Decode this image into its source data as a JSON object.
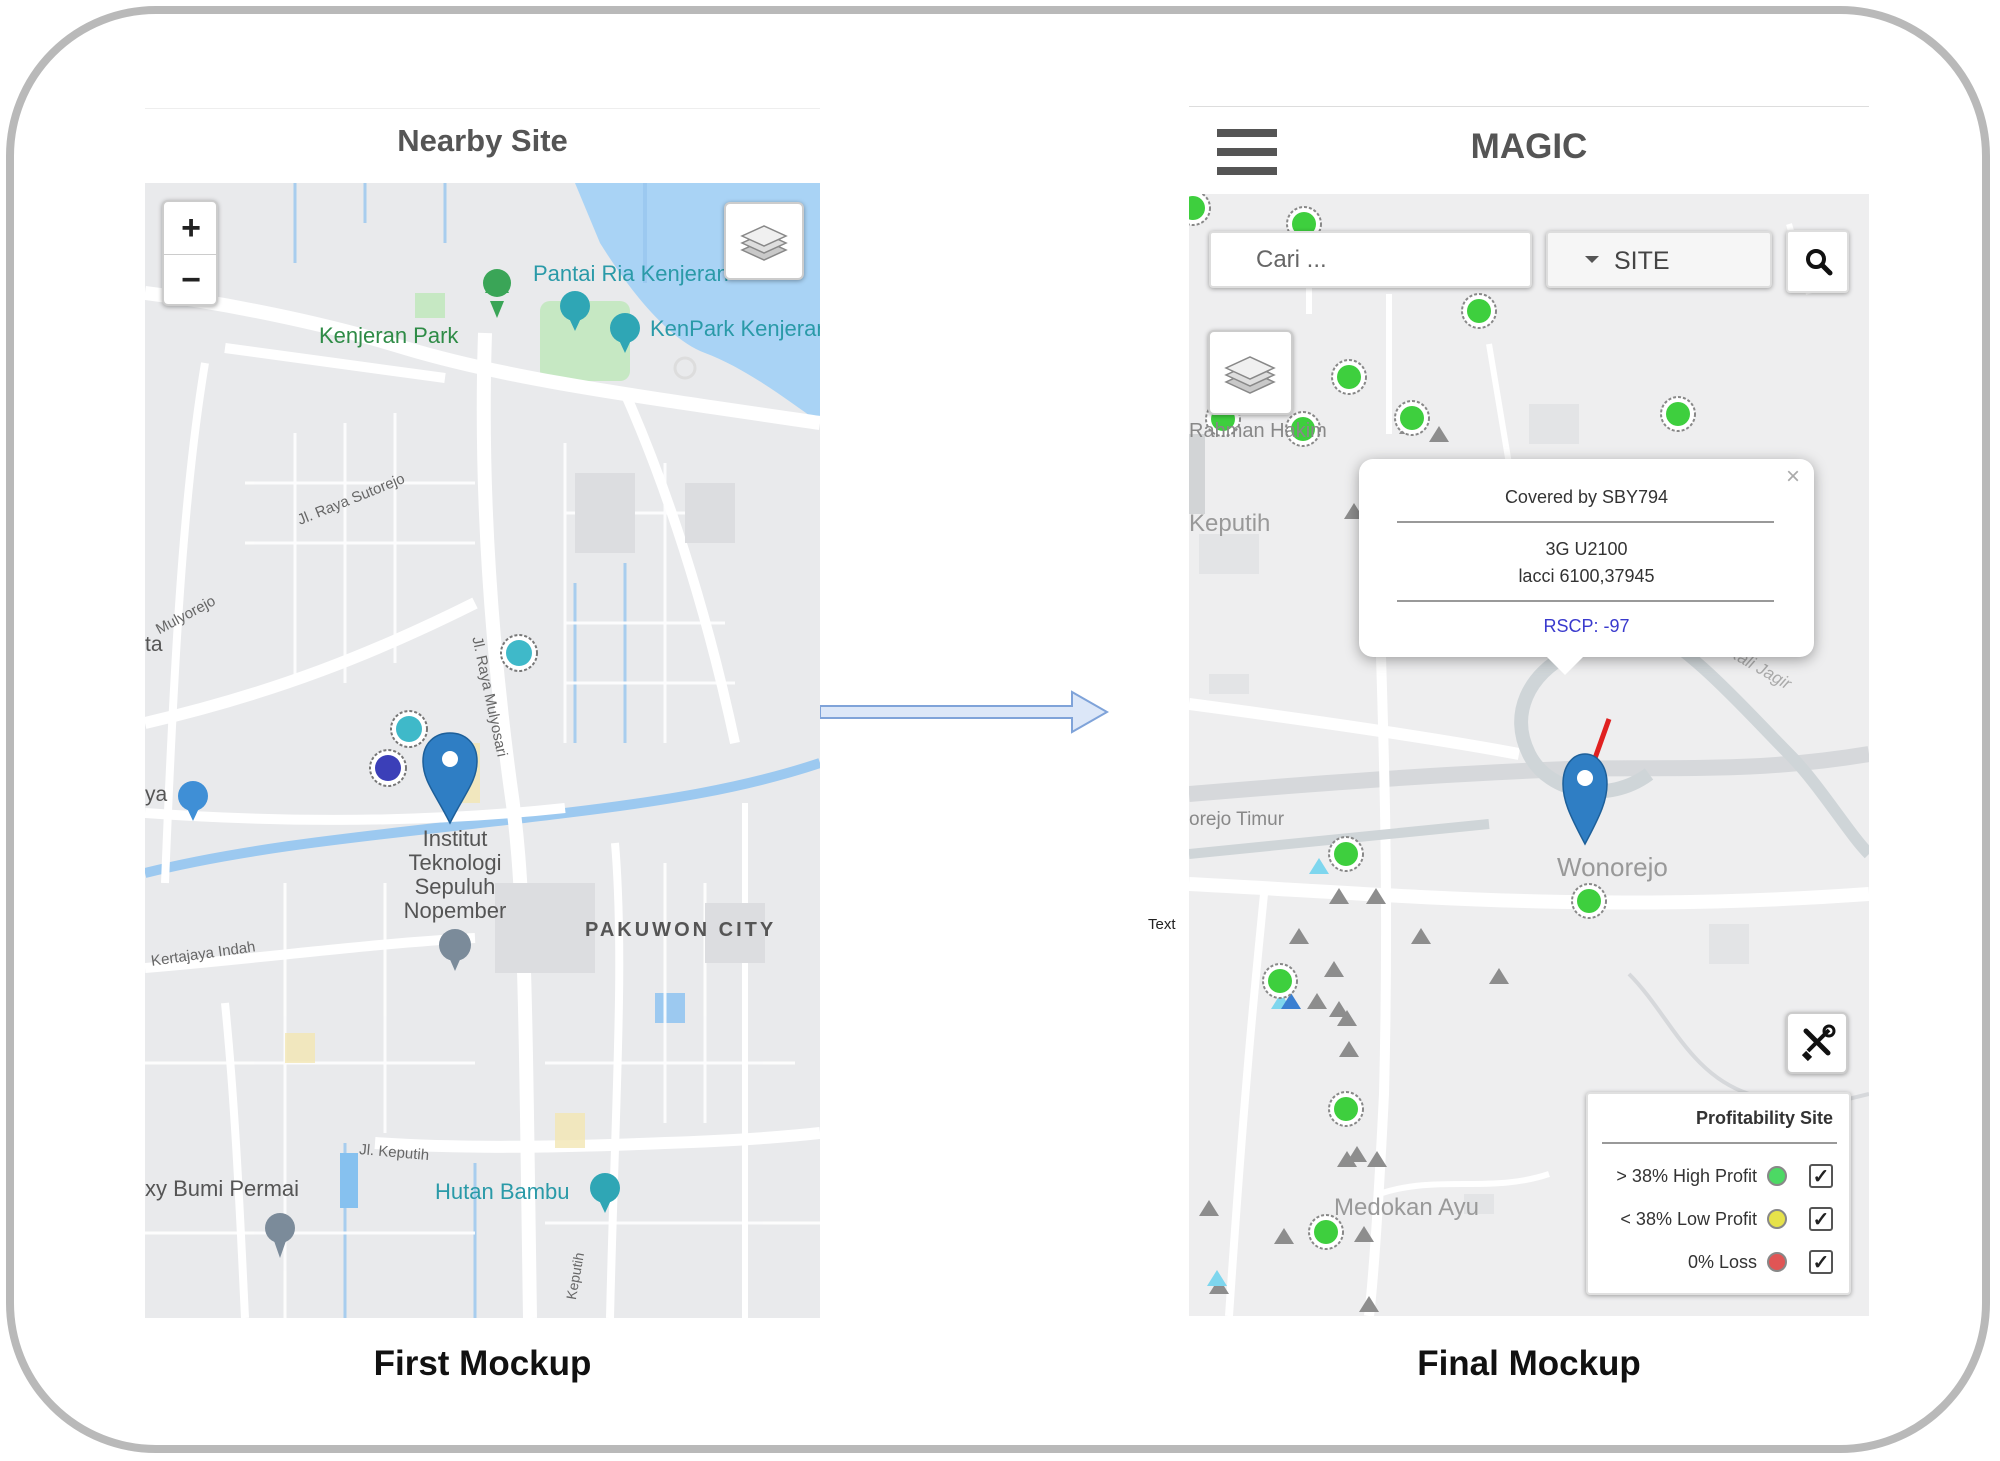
{
  "first": {
    "header_title": "Nearby Site",
    "caption": "First Mockup",
    "zoom_in": "+",
    "zoom_out": "−",
    "places": {
      "pantai": "Pantai Ria Kenjeran",
      "kenjeran_park": "Kenjeran Park",
      "kenpark": "KenPark Kenjeran",
      "sutorejo": "Jl. Raya Sutorejo",
      "mulyorejo": "Mulyorejo",
      "ta": "ta",
      "mulyosari": "Jl. Raya Mulyosari",
      "ya": "ya",
      "its": [
        "Institut",
        "Teknologi",
        "Sepuluh",
        "Nopember"
      ],
      "pakuwon": "PAKUWON CITY",
      "kertajaya": "Kertajaya Indah",
      "keputih": "Jl. Keputih",
      "bumi_permai": "xy Bumi Permai",
      "hutan_bambu": "Hutan Bambu",
      "keputih_road": "Keputih"
    }
  },
  "final": {
    "app_title": "MAGIC",
    "caption": "Final Mockup",
    "search_placeholder": "Cari ...",
    "site_dropdown": "SITE",
    "places": {
      "rahman": "Rahman Hakim",
      "keputih": "Keputih",
      "orejo_timur": "orejo Timur",
      "wonorejo": "Wonorejo",
      "medokan": "Medokan Ayu",
      "kali_jagir": "Kali Jagir"
    },
    "popup": {
      "title": "Covered by SBY794",
      "tech": "3G U2100",
      "lacci": "lacci 6100,37945",
      "rscp": "RSCP: -97",
      "close": "×"
    },
    "legend": {
      "title": "Profitability Site",
      "items": [
        {
          "label": "> 38% High Profit",
          "color": "#4cd964"
        },
        {
          "label": "< 38% Low Profit",
          "color": "#e6e24a"
        },
        {
          "label": "0% Loss",
          "color": "#e05555"
        }
      ]
    }
  },
  "connector": {
    "text": "Text"
  },
  "colors": {
    "site_green": "#3ecf3e",
    "marker_blue": "#2f7ec4",
    "site_cyan": "#3fb9c9",
    "site_navy": "#3b3fb8",
    "water": "#a9d3f5",
    "park": "#c6e8c3",
    "arrow_fill": "#dce7f8",
    "arrow_stroke": "#7fa3d9"
  }
}
